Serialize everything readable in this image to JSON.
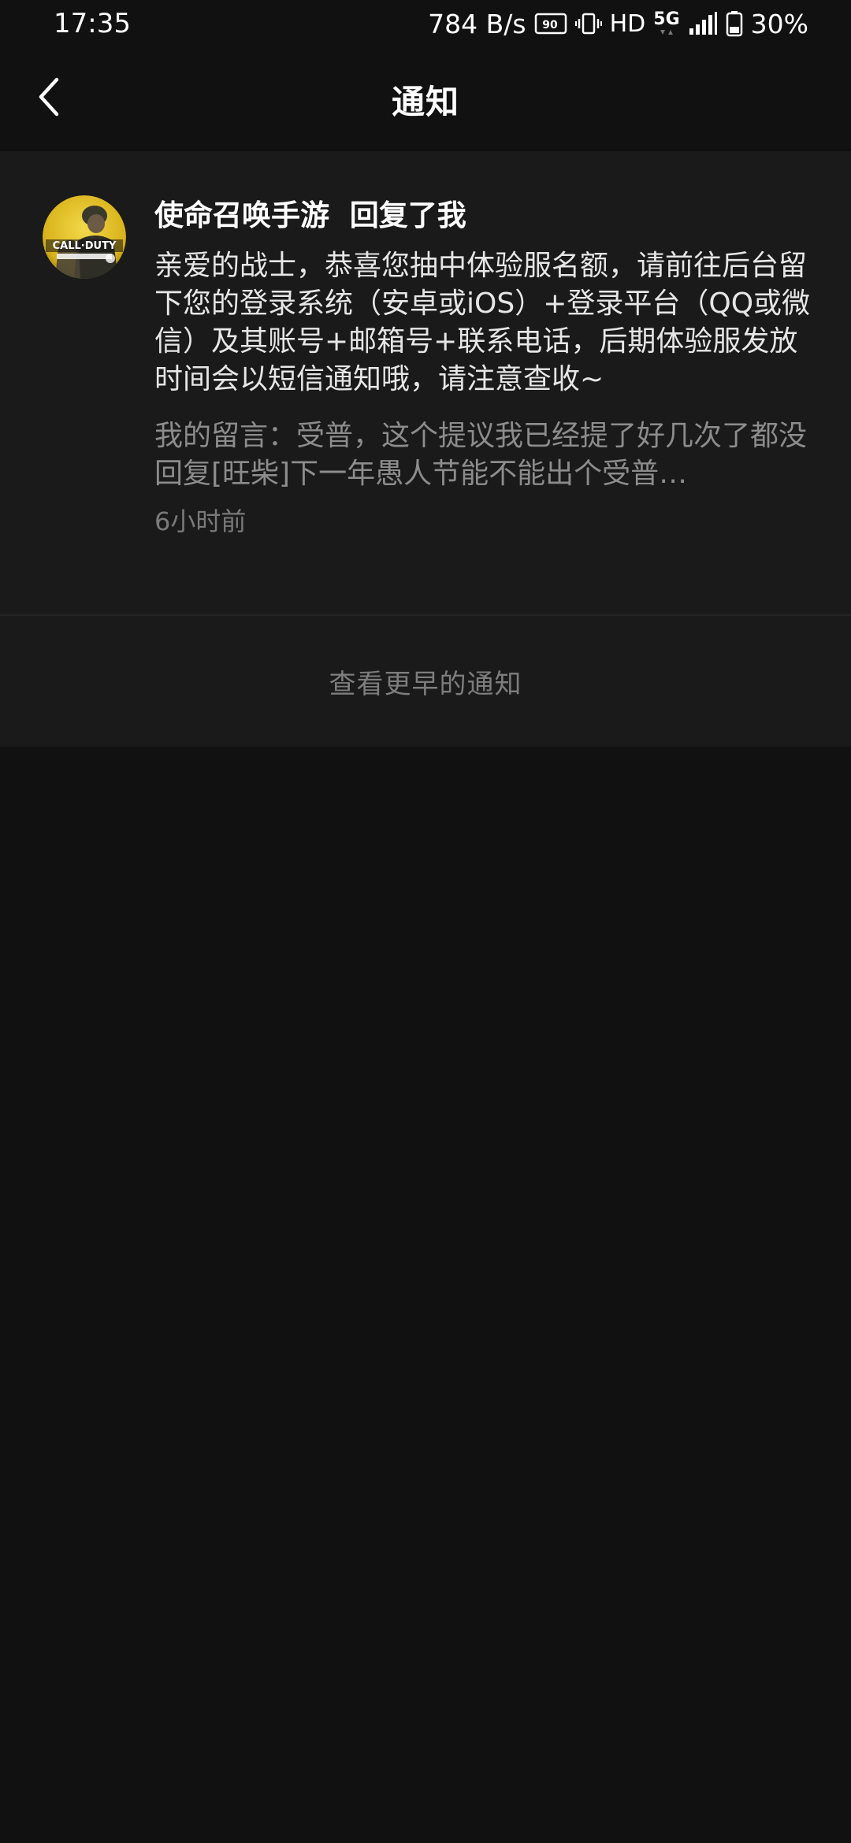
{
  "status_bar": {
    "time": "17:35",
    "network_speed": "784 B/s",
    "refresh_rate_badge": "90",
    "hd": "HD",
    "network_type": "5G",
    "battery": "30%",
    "icons": [
      "refresh-rate-icon",
      "vibrate-icon",
      "signal-icon",
      "battery-icon"
    ]
  },
  "header": {
    "title": "通知",
    "back_icon": "chevron-left-icon"
  },
  "notification": {
    "avatar_text": "CALL·DUTY",
    "title": "使命召唤手游  回复了我",
    "message": "亲爱的战士，恭喜您抽中体验服名额，请前往后台留下您的登录系统（安卓或iOS）+登录平台（QQ或微信）及其账号+邮箱号+联系电话，后期体验服发放时间会以短信通知哦，请注意查收~",
    "quote_prefix": "我的留言：",
    "quote_text": "受普，这个提议我已经提了好几次了都没回复[旺柴]下一年愚人节能不能出个受普…",
    "time": "6小时前"
  },
  "more": {
    "label": "查看更早的通知"
  },
  "colors": {
    "background": "#111111",
    "card": "#1a1a1a",
    "primary_text": "#ffffff",
    "secondary_text": "#8c8c8c",
    "accent_yellow": "#e8c21a"
  }
}
